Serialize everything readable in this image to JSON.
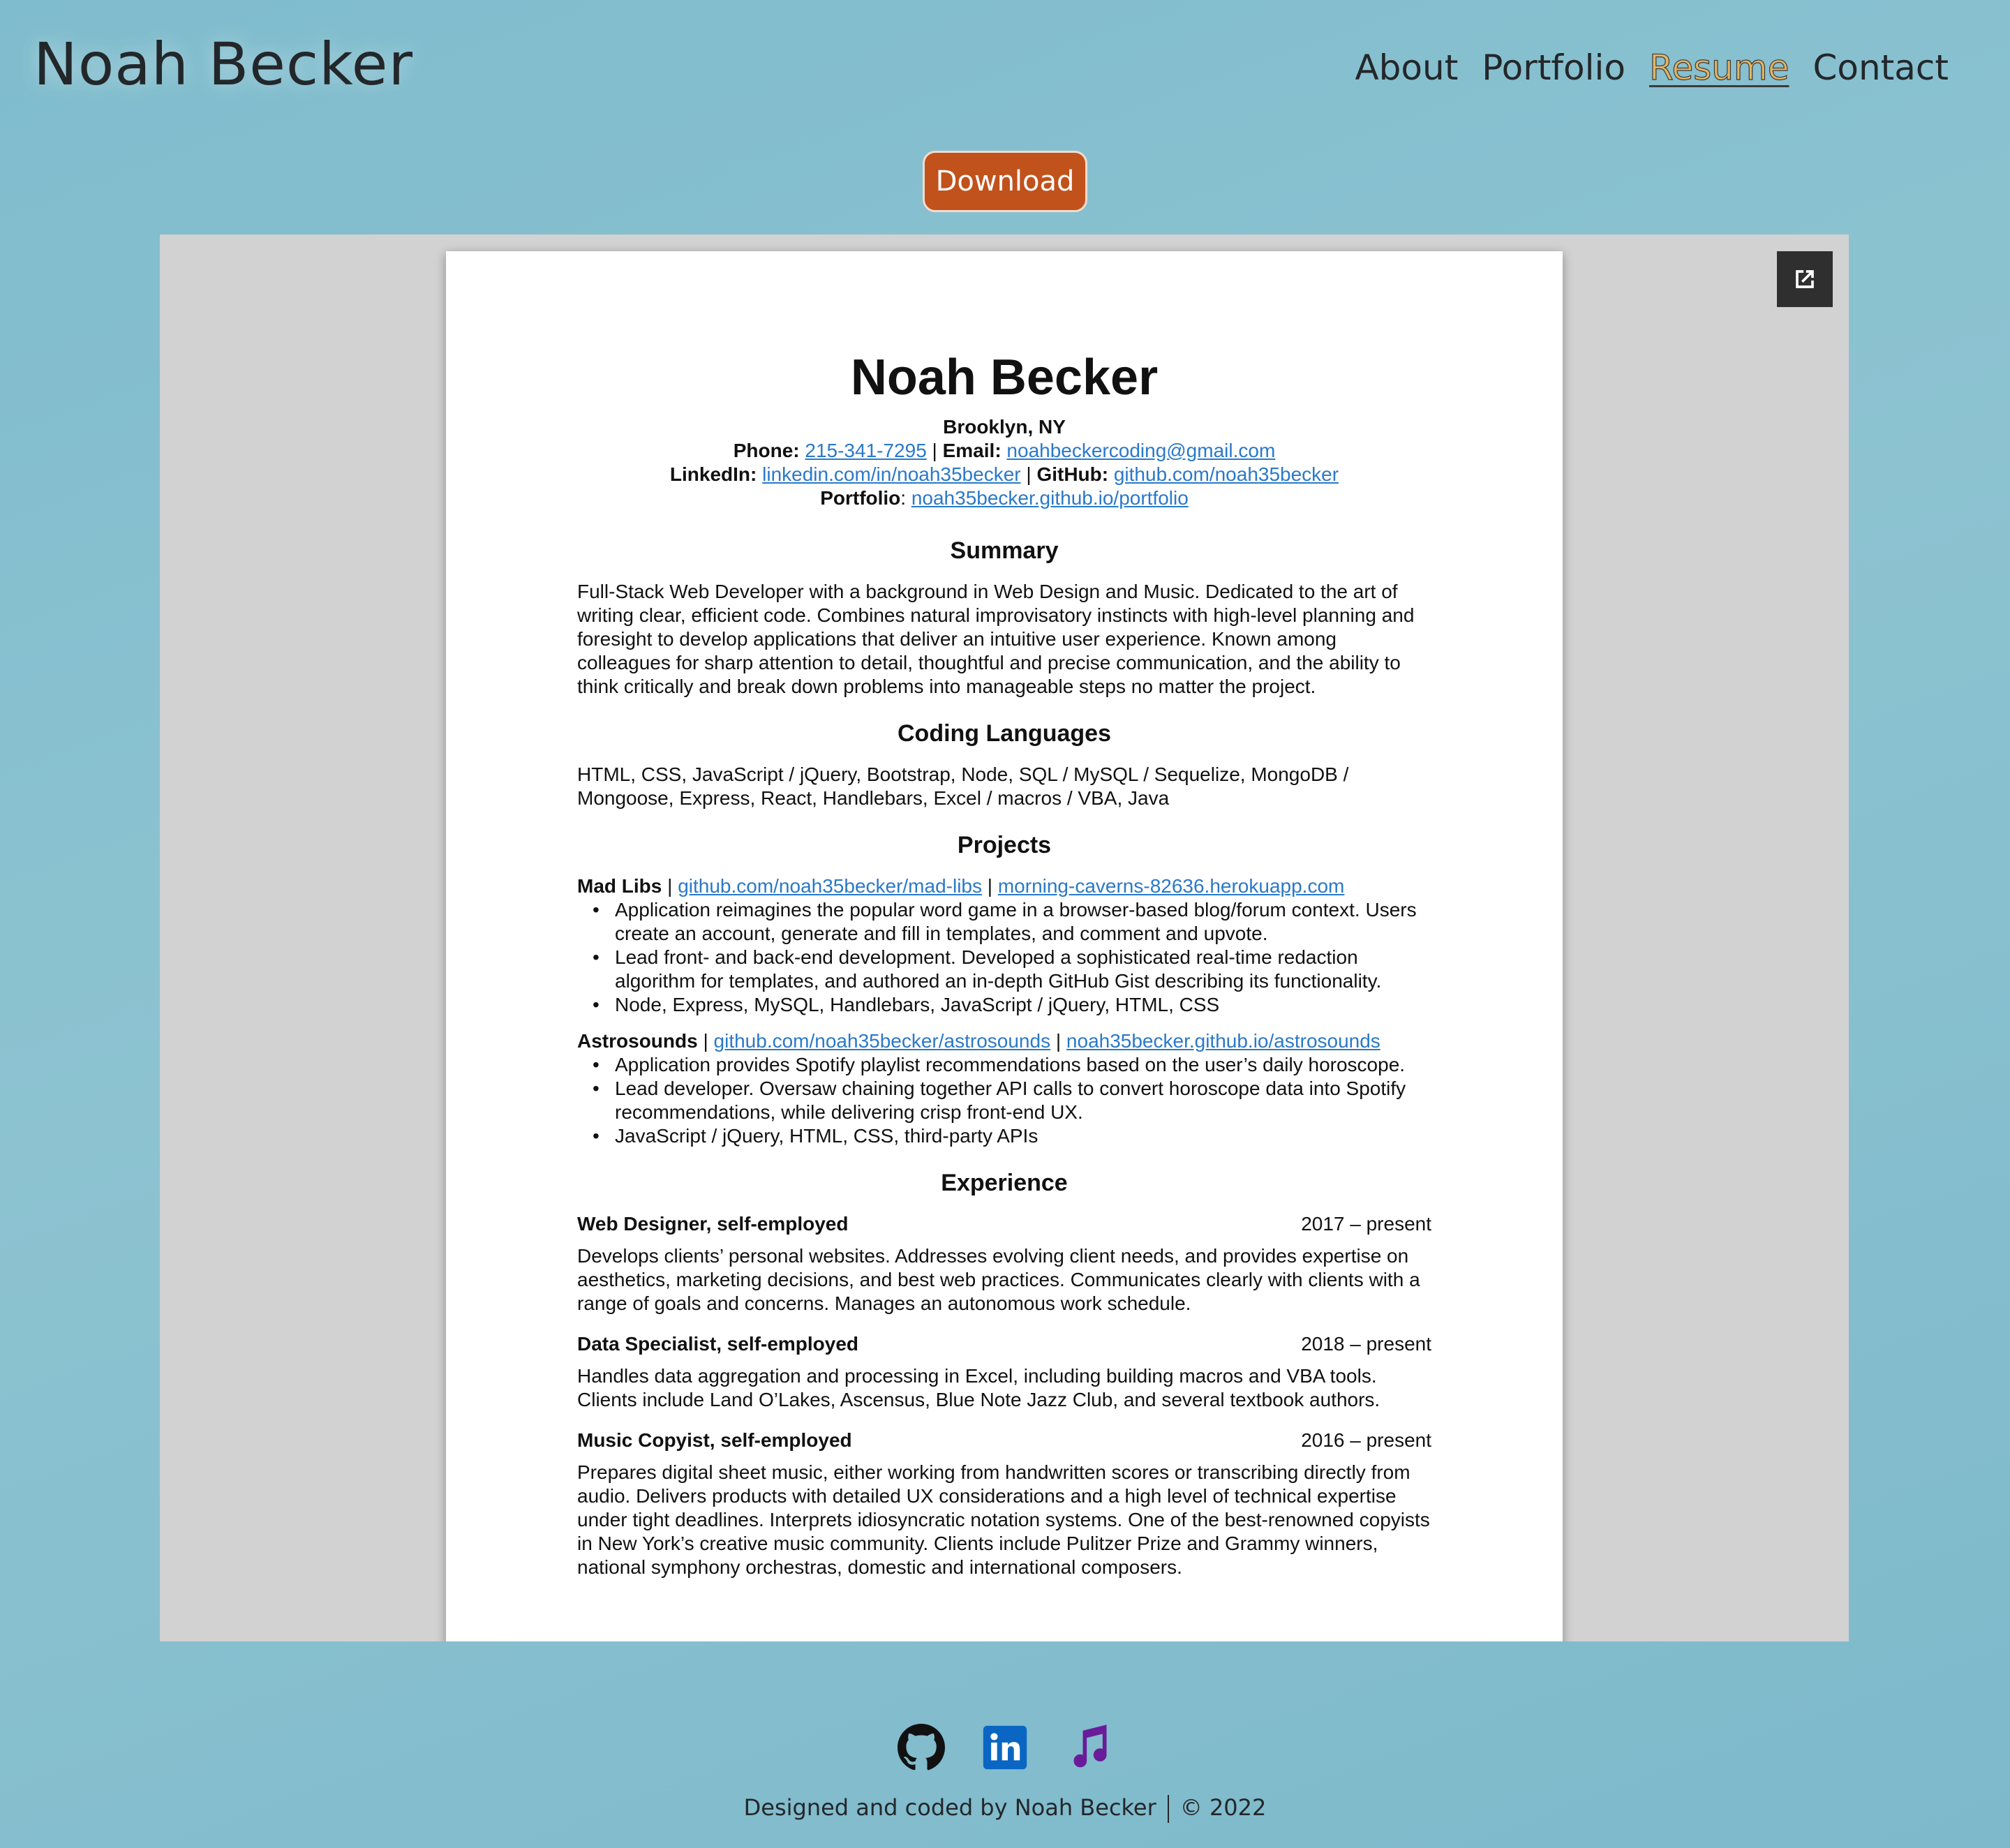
{
  "header": {
    "brand": "Noah Becker",
    "nav": [
      "About",
      "Portfolio",
      "Resume",
      "Contact"
    ],
    "active_nav": "Resume"
  },
  "download_label": "Download",
  "viewer": {
    "popout_icon": "external-link-icon",
    "resume": {
      "name": "Noah Becker",
      "location": "Brooklyn, NY",
      "phone_label": "Phone:",
      "phone": "215-341-7295",
      "email_label": "Email:",
      "email": "noahbeckercoding@gmail.com",
      "linkedin_label": "LinkedIn:",
      "linkedin": "linkedin.com/in/noah35becker",
      "github_label": "GitHub:",
      "github": "github.com/noah35becker",
      "portfolio_label": "Portfolio",
      "portfolio": "noah35becker.github.io/portfolio",
      "summary_title": "Summary",
      "summary": "Full-Stack Web Developer with a background in Web Design and Music. Dedicated to the art of writing clear, efficient code. Combines natural improvisatory instincts with high-level planning and foresight to develop applications that deliver an intuitive user experience. Known among colleagues for sharp attention to detail, thoughtful and precise communication, and the ability to think critically and break down problems into manageable steps no matter the project.",
      "languages_title": "Coding Languages",
      "languages": "HTML, CSS, JavaScript / jQuery, Bootstrap, Node, SQL / MySQL / Sequelize, MongoDB / Mongoose, Express, React, Handlebars, Excel / macros / VBA, Java",
      "projects_title": "Projects",
      "projects": [
        {
          "name": "Mad Libs",
          "link1": "github.com/noah35becker/mad-libs",
          "link2": "morning-caverns-82636.herokuapp.com",
          "bullets": [
            "Application reimagines the popular word game in a browser-based blog/forum context. Users create an account, generate and fill in templates, and comment and upvote.",
            "Lead front- and back-end development. Developed a sophisticated real-time redaction algorithm for templates, and authored an in-depth GitHub Gist describing its functionality.",
            "Node, Express, MySQL, Handlebars, JavaScript / jQuery, HTML, CSS"
          ]
        },
        {
          "name": "Astrosounds",
          "link1": "github.com/noah35becker/astrosounds",
          "link2": "noah35becker.github.io/astrosounds",
          "bullets": [
            "Application provides Spotify playlist recommendations based on the user’s daily horoscope.",
            "Lead developer. Oversaw chaining together API calls to convert horoscope data into Spotify recommendations, while delivering crisp front-end UX.",
            "JavaScript / jQuery, HTML, CSS, third-party APIs"
          ]
        }
      ],
      "experience_title": "Experience",
      "jobs": [
        {
          "title": "Web Designer, self-employed",
          "dates": "2017 – present",
          "desc": "Develops clients’ personal websites. Addresses evolving client needs, and provides expertise on aesthetics, marketing decisions, and best web practices. Communicates clearly with clients with a range of goals and concerns. Manages an autonomous work schedule."
        },
        {
          "title": "Data Specialist, self-employed",
          "dates": "2018 – present",
          "desc": "Handles data aggregation and processing in Excel, including building macros and VBA tools. Clients include Land O’Lakes, Ascensus, Blue Note Jazz Club, and several textbook authors."
        },
        {
          "title": "Music Copyist, self-employed",
          "dates": "2016 – present",
          "desc": "Prepares digital sheet music, either working from handwritten scores or transcribing directly from audio. Delivers products with detailed UX considerations and a high level of technical expertise under tight deadlines. Interprets idiosyncratic notation systems. One of the best-renowned copyists in New York’s creative music community. Clients include Pulitzer Prize and Grammy winners, national symphony orchestras, domestic and international composers."
        }
      ]
    }
  },
  "footer": {
    "icons": [
      "github-icon",
      "linkedin-icon",
      "music-note-icon"
    ],
    "credit": "Designed and coded by Noah Becker",
    "copyright": "© 2022"
  },
  "colors": {
    "background": "#8dc3d1",
    "accent": "#c1521b",
    "active_nav": "#e3b464",
    "linkedin": "#0a66c2",
    "music": "#6a1b9a"
  }
}
